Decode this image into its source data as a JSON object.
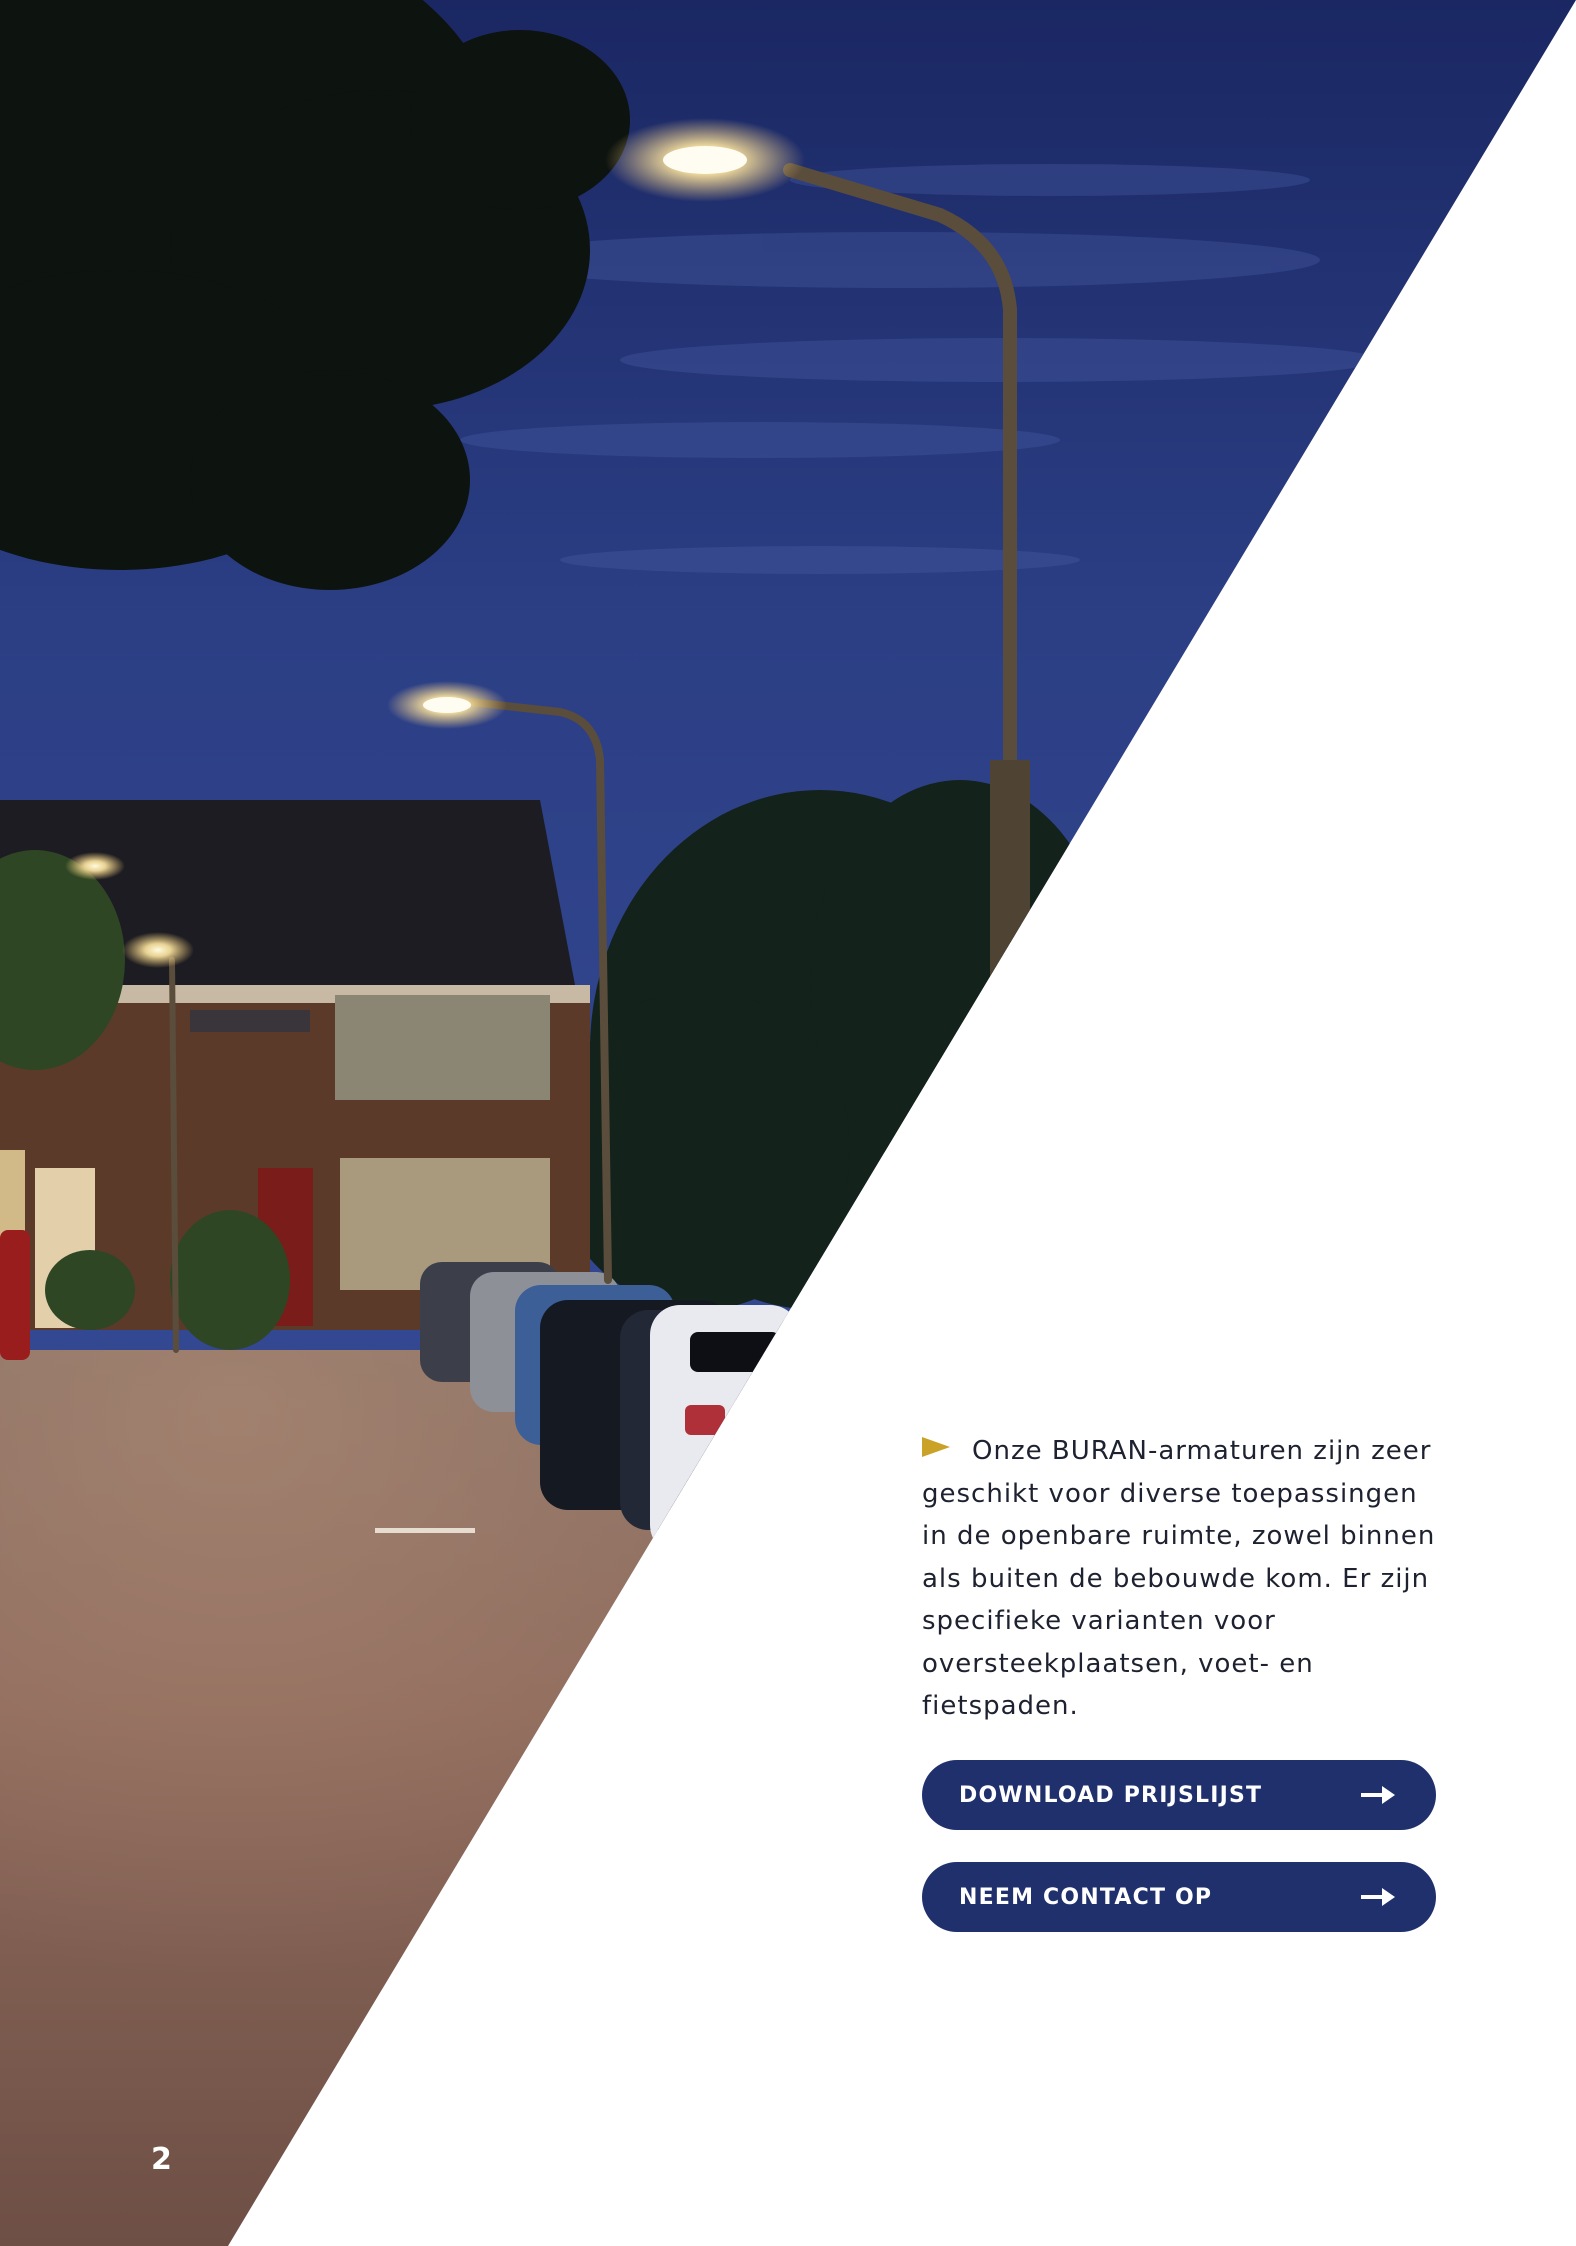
{
  "photo": {
    "subject": "street-at-dusk-with-lampposts",
    "colors": {
      "sky": "#1d2e6e",
      "road": "#7a5c4f",
      "house": "#5a3a2c"
    }
  },
  "body": {
    "marker_color": "#c9a227",
    "text": "Onze BURAN-armaturen zijn zeer geschikt voor diverse toepassingen in de openbare ruimte, zowel binnen als buiten de bebouwde kom. Er zijn specifieke varianten voor oversteekplaatsen, voet- en fietspaden."
  },
  "buttons": {
    "color": "#20306c",
    "download": {
      "label": "DOWNLOAD PRIJSLIJST",
      "icon": "arrow-right-icon"
    },
    "contact": {
      "label": "NEEM CONTACT OP",
      "icon": "arrow-right-icon"
    }
  },
  "page_number": "2"
}
